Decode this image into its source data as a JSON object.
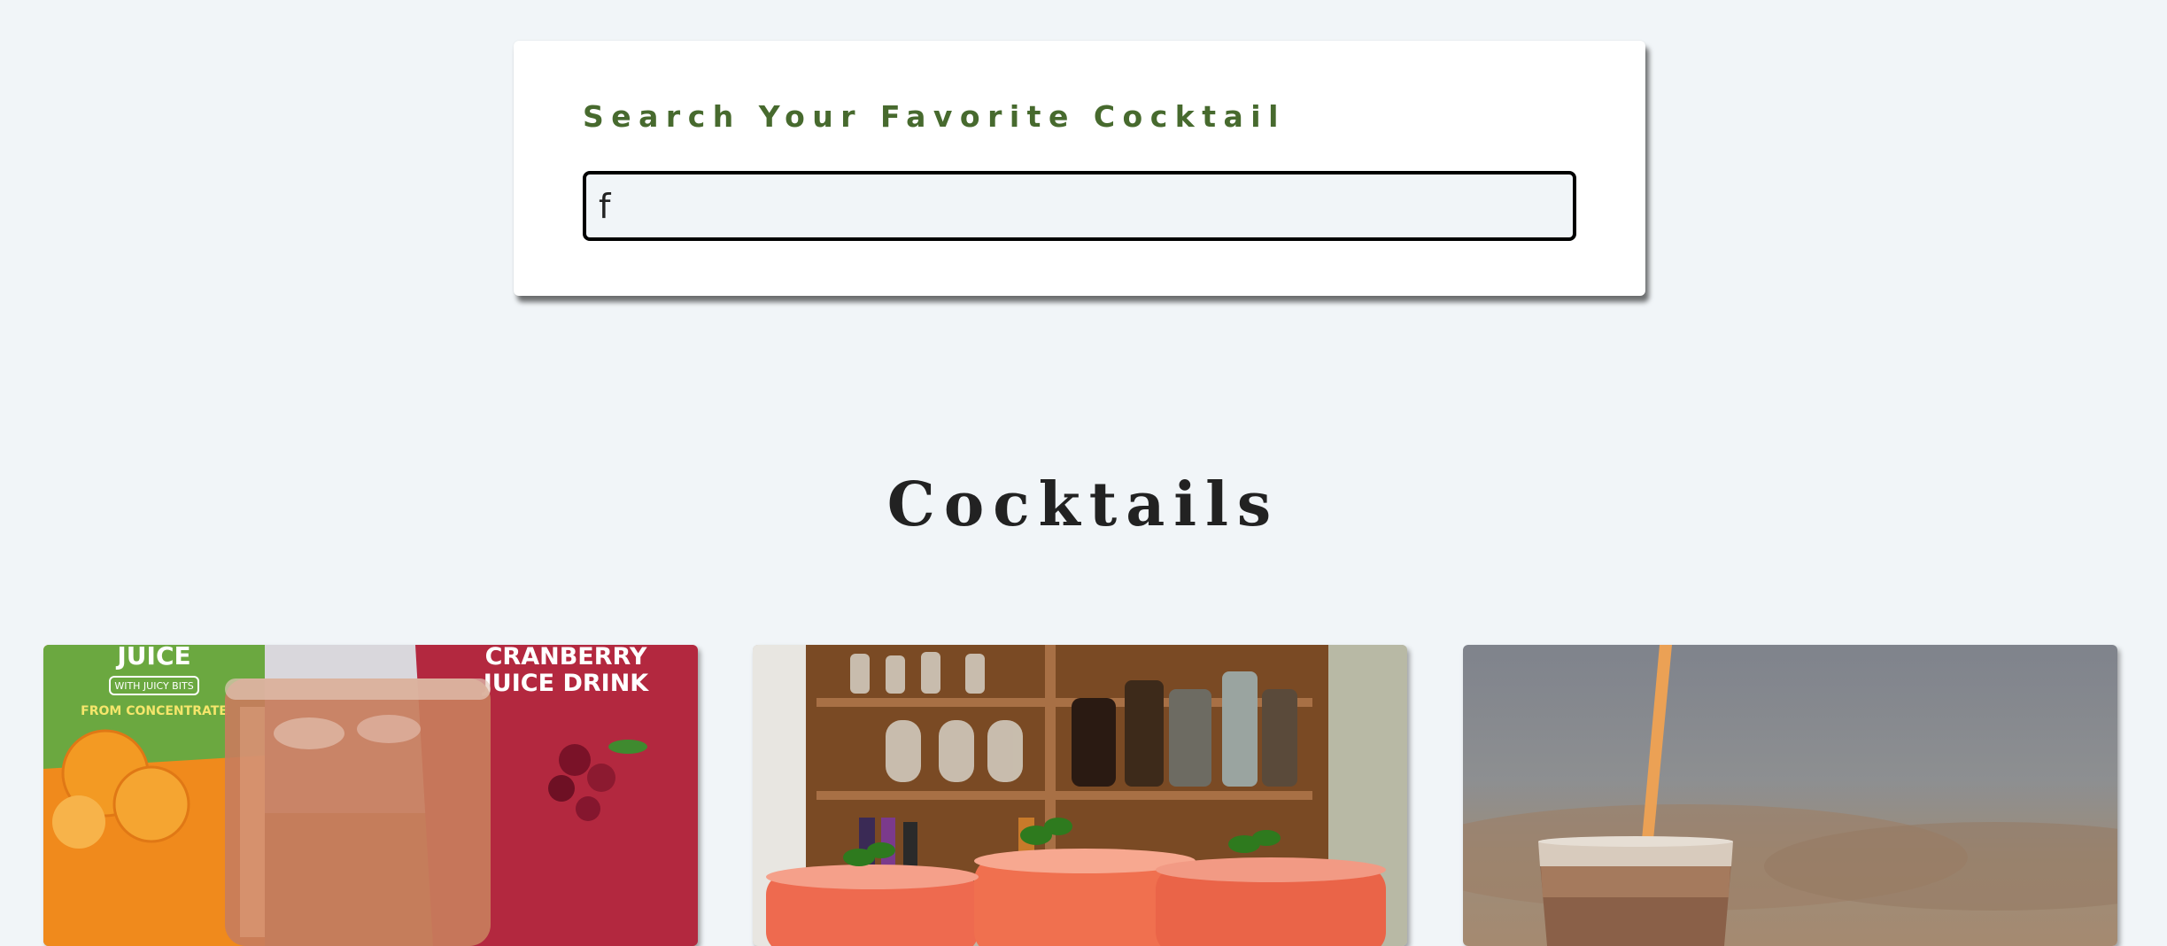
{
  "search": {
    "label": "Search Your Favorite Cocktail",
    "value": "f"
  },
  "cocktails": {
    "title": "Cocktails",
    "cards": [
      {
        "image_text_1": "JUICE",
        "image_text_2": "WITH JUICY BITS",
        "image_text_3": "FROM CONCENTRATE",
        "image_text_4": "CRANBERRY",
        "image_text_5": "JUICE DRINK"
      },
      {},
      {}
    ]
  },
  "colors": {
    "background": "#f1f5f8",
    "label_green": "#476a2e",
    "title": "#222222"
  }
}
